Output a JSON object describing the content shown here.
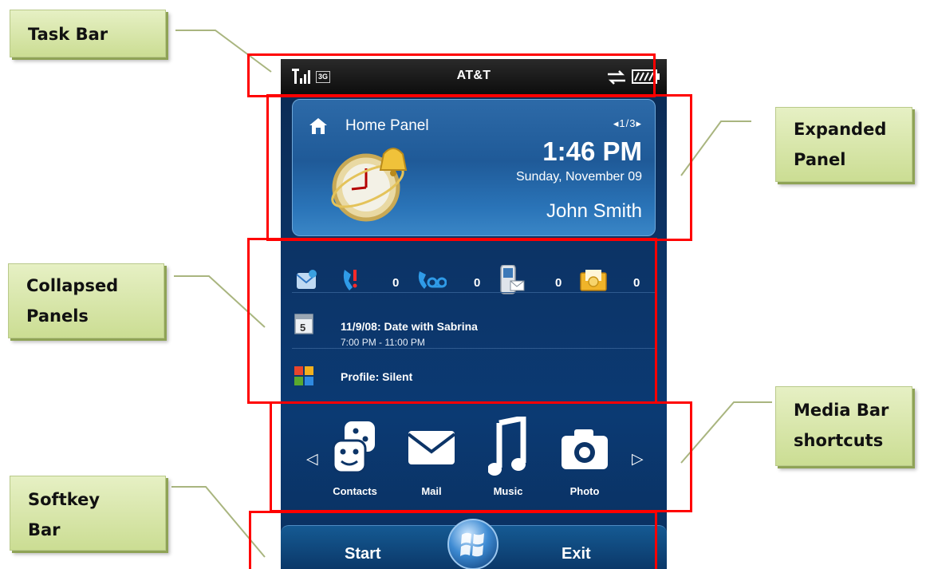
{
  "callouts": {
    "task_bar": "Task Bar",
    "expanded_panel_line1": "Expanded",
    "expanded_panel_line2": "Panel",
    "collapsed_panels_line1": "Collapsed",
    "collapsed_panels_line2": "Panels",
    "media_bar_line1": "Media Bar",
    "media_bar_line2": "shortcuts",
    "softkey_bar_line1": "Softkey",
    "softkey_bar_line2": "Bar"
  },
  "taskbar": {
    "signal_icon": "signal-strength-icon",
    "network_badge": "3G",
    "carrier": "AT&T",
    "sync_icon": "data-sync-icon",
    "battery_icon": "battery-icon"
  },
  "home_panel": {
    "icon": "home-icon",
    "title": "Home Panel",
    "page_indicator": "◂1/3▸",
    "time": "1:46 PM",
    "date": "Sunday, November 09",
    "owner": "John Smith"
  },
  "notifications": [
    {
      "icon": "email-envelope-icon",
      "count": ""
    },
    {
      "icon": "missed-call-icon",
      "count": "0"
    },
    {
      "icon": "voicemail-icon",
      "count": "0"
    },
    {
      "icon": "text-message-icon",
      "count": "0"
    },
    {
      "icon": "email-inbox-icon",
      "count": "0"
    }
  ],
  "appointment": {
    "icon": "calendar-icon",
    "title": "11/9/08: Date with Sabrina",
    "time": "7:00 PM - 11:00 PM"
  },
  "profile": {
    "icon": "windows-profile-icon",
    "label": "Profile: Silent"
  },
  "media_bar": {
    "items": [
      {
        "label": "Contacts",
        "icon": "contacts-icon"
      },
      {
        "label": "Mail",
        "icon": "mail-icon"
      },
      {
        "label": "Music",
        "icon": "music-note-icon"
      },
      {
        "label": "Photo",
        "icon": "camera-icon"
      }
    ],
    "left_arrow": "◁",
    "right_arrow": "▷"
  },
  "softkeys": {
    "left": "Start",
    "right": "Exit",
    "center_icon": "windows-start-orb-icon"
  },
  "colors": {
    "highlight": "#ff0000",
    "callout_fill": "#d7e6a8",
    "screen_bg": "#0c3467"
  }
}
